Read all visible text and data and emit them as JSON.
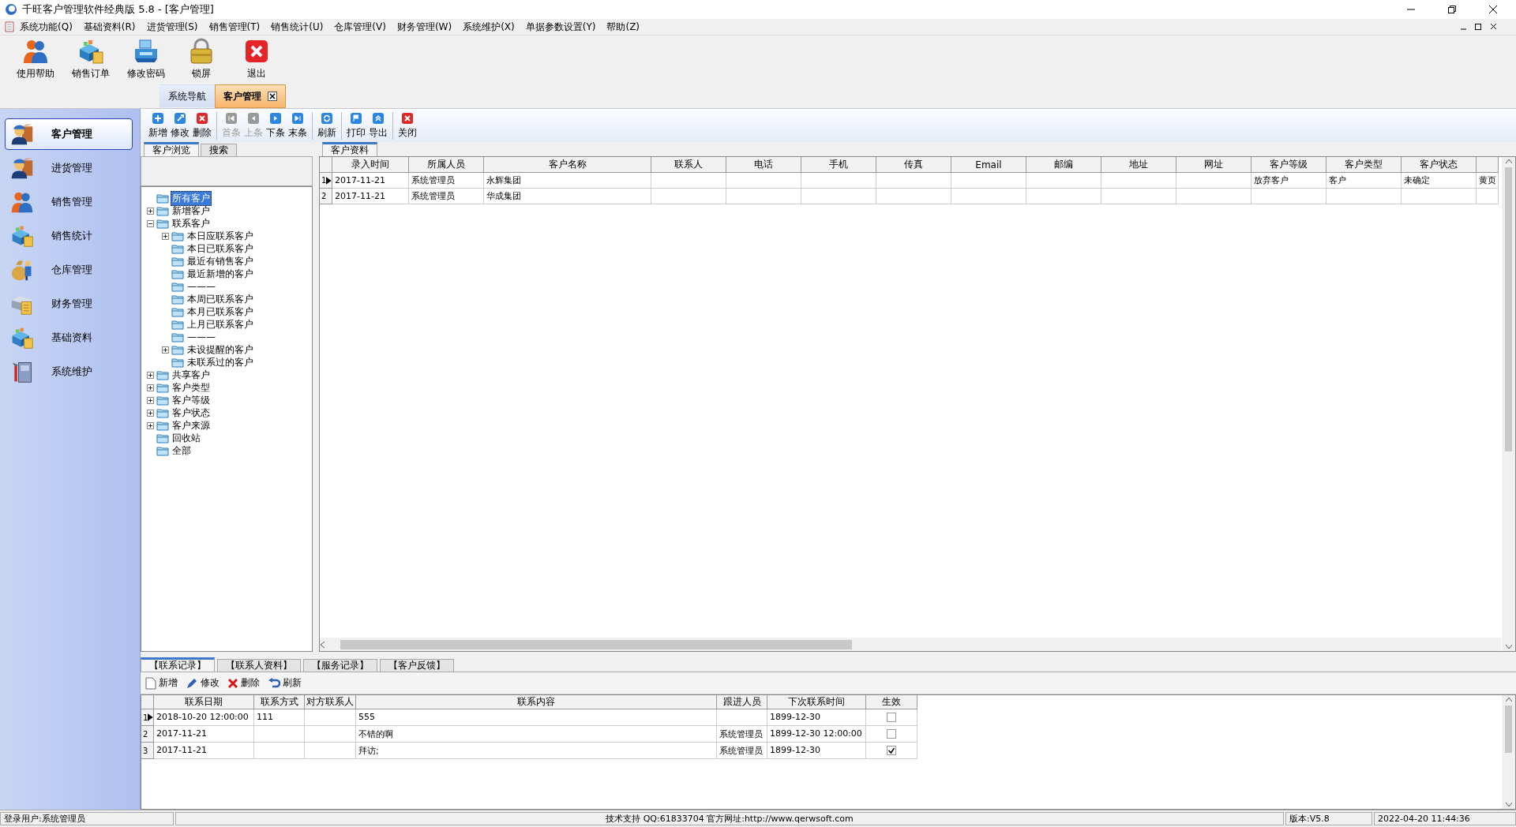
{
  "window": {
    "title": "千旺客户管理软件经典版 5.8 - [客户管理]"
  },
  "menu": [
    "系统功能(Q)",
    "基础资料(R)",
    "进货管理(S)",
    "销售管理(T)",
    "销售统计(U)",
    "仓库管理(V)",
    "财务管理(W)",
    "系统维护(X)",
    "单据参数设置(Y)",
    "帮助(Z)"
  ],
  "toolbar": [
    {
      "label": "使用帮助",
      "kind": "people"
    },
    {
      "label": "销售订单",
      "kind": "box"
    },
    {
      "label": "修改密码",
      "kind": "printer"
    },
    {
      "label": "锁屏",
      "kind": "lock"
    },
    {
      "label": "退出",
      "kind": "exit"
    }
  ],
  "doc_tabs": [
    {
      "label": "系统导航",
      "selected": false,
      "closable": false
    },
    {
      "label": "客户管理",
      "selected": true,
      "closable": true
    }
  ],
  "sidebar": {
    "items": [
      {
        "label": "客户管理",
        "selected": true,
        "kind": "worker"
      },
      {
        "label": "进货管理",
        "selected": false,
        "kind": "worker"
      },
      {
        "label": "销售管理",
        "selected": false,
        "kind": "people"
      },
      {
        "label": "销售统计",
        "selected": false,
        "kind": "box"
      },
      {
        "label": "仓库管理",
        "selected": false,
        "kind": "bag"
      },
      {
        "label": "财务管理",
        "selected": false,
        "kind": "calc"
      },
      {
        "label": "基础资料",
        "selected": false,
        "kind": "box"
      },
      {
        "label": "系统维护",
        "selected": false,
        "kind": "tools"
      }
    ]
  },
  "record_toolbar": [
    [
      {
        "label": "新增",
        "kind": "plus",
        "disabled": false
      },
      {
        "label": "修改",
        "kind": "wrench",
        "disabled": false
      },
      {
        "label": "删除",
        "kind": "delete",
        "disabled": false
      }
    ],
    [
      {
        "label": "首条",
        "kind": "first",
        "disabled": true
      },
      {
        "label": "上条",
        "kind": "prev",
        "disabled": true
      },
      {
        "label": "下条",
        "kind": "next",
        "disabled": false
      },
      {
        "label": "末条",
        "kind": "last",
        "disabled": false
      }
    ],
    [
      {
        "label": "刷新",
        "kind": "refresh",
        "disabled": false
      }
    ],
    [
      {
        "label": "打印",
        "kind": "flag",
        "disabled": false
      },
      {
        "label": "导出",
        "kind": "up",
        "disabled": false
      }
    ],
    [
      {
        "label": "关闭",
        "kind": "delete",
        "disabled": false
      }
    ]
  ],
  "tree_tabs": [
    {
      "label": "客户浏览",
      "selected": true
    },
    {
      "label": "搜索",
      "selected": false
    }
  ],
  "tree": [
    {
      "label": "所有客户",
      "selected": true
    },
    {
      "label": "新增客户",
      "selected": false,
      "expanded": false
    },
    {
      "label": "联系客户",
      "selected": false,
      "expanded": true,
      "children": [
        {
          "label": "本日应联系客户",
          "selected": false,
          "expanded": false
        },
        {
          "label": "本日已联系客户",
          "selected": false
        },
        {
          "label": "最近有销售客户",
          "selected": false
        },
        {
          "label": "最近新增的客户",
          "selected": false
        },
        {
          "label": "———",
          "selected": false
        },
        {
          "label": "本周已联系客户",
          "selected": false
        },
        {
          "label": "本月已联系客户",
          "selected": false
        },
        {
          "label": "上月已联系客户",
          "selected": false
        },
        {
          "label": "———",
          "selected": false
        },
        {
          "label": "未设提醒的客户",
          "selected": false,
          "expanded": false
        },
        {
          "label": "未联系过的客户",
          "selected": false
        }
      ]
    },
    {
      "label": "共享客户",
      "selected": false,
      "expanded": false
    },
    {
      "label": "客户类型",
      "selected": false,
      "expanded": false
    },
    {
      "label": "客户等级",
      "selected": false,
      "expanded": false
    },
    {
      "label": "客户状态",
      "selected": false,
      "expanded": false
    },
    {
      "label": "客户来源",
      "selected": false,
      "expanded": false
    },
    {
      "label": "回收站",
      "selected": false
    },
    {
      "label": "全部",
      "selected": false
    }
  ],
  "grid_tabs": [
    {
      "label": "客户资料",
      "selected": true
    }
  ],
  "customers": {
    "columns": [
      "录入时间",
      "所属人员",
      "客户名称",
      "联系人",
      "电话",
      "手机",
      "传真",
      "Email",
      "邮编",
      "地址",
      "网址",
      "客户等级",
      "客户类型",
      "客户状态"
    ],
    "rows": [
      {
        "number": "1",
        "selected": true,
        "cells": [
          "2017-11-21",
          "系统管理员",
          "永辉集团",
          "",
          "",
          "",
          "",
          "",
          "",
          "",
          "",
          "放弃客户",
          "客户",
          "未确定",
          "黄页"
        ]
      },
      {
        "number": "2",
        "selected": false,
        "cells": [
          "2017-11-21",
          "系统管理员",
          "华成集团",
          "",
          "",
          "",
          "",
          "",
          "",
          "",
          "",
          "",
          "",
          "",
          ""
        ]
      }
    ]
  },
  "detail_tabs": [
    {
      "label": "【联系记录】",
      "selected": true
    },
    {
      "label": "【联系人资料】",
      "selected": false
    },
    {
      "label": "【服务记录】",
      "selected": false
    },
    {
      "label": "【客户反馈】",
      "selected": false
    }
  ],
  "detail_toolbar": [
    {
      "label": "新增",
      "kind": "page"
    },
    {
      "label": "修改",
      "kind": "pen"
    },
    {
      "label": "删除",
      "kind": "cross"
    },
    {
      "label": "刷新",
      "kind": "back"
    }
  ],
  "contacts": {
    "columns": [
      "联系日期",
      "联系方式",
      "对方联系人",
      "联系内容",
      "跟进人员",
      "下次联系时间",
      "生效"
    ],
    "rows": [
      {
        "number": "1",
        "selected": true,
        "cells": [
          "2018-10-20 12:00:00",
          "111",
          "",
          "555",
          "",
          "1899-12-30"
        ],
        "effective": false
      },
      {
        "number": "2",
        "selected": false,
        "cells": [
          "2017-11-21",
          "",
          "",
          "不错的啊",
          "系统管理员",
          "1899-12-30 12:00:00"
        ],
        "effective": false
      },
      {
        "number": "3",
        "selected": false,
        "cells": [
          "2017-11-21",
          "",
          "",
          "拜访;",
          "系统管理员",
          "1899-12-30"
        ],
        "effective": true
      }
    ]
  },
  "status_bar": [
    "登录用户:系统管理员",
    "技术支持 QQ:61833704 官方网址:http://www.qerwsoft.com",
    "版本:V5.8",
    "2022-04-20 11:44:36"
  ]
}
